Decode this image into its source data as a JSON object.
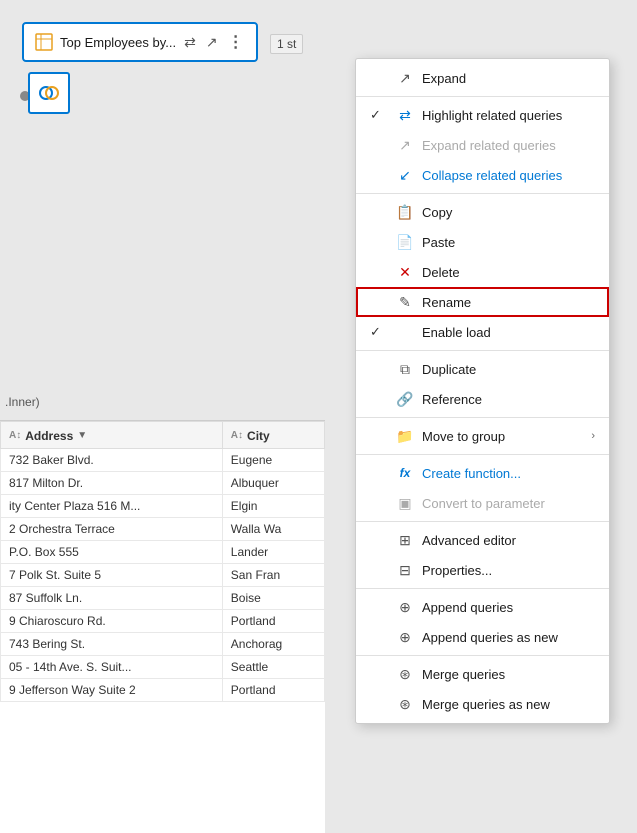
{
  "queryCard": {
    "title": "Top Employees by...",
    "stepBadge": "1 st",
    "actions": {
      "share": "⇄",
      "expand": "↗",
      "more": "⋮"
    }
  },
  "tableLabel": ".Inner)",
  "tableColumns": [
    {
      "id": "address",
      "label": "Address",
      "type": "abc"
    },
    {
      "id": "city",
      "label": "City",
      "type": "abc"
    }
  ],
  "tableRows": [
    {
      "address": "732 Baker Blvd.",
      "city": "Eugene"
    },
    {
      "address": "817 Milton Dr.",
      "city": "Albuquer"
    },
    {
      "address": "ity Center Plaza 516 M...",
      "city": "Elgin"
    },
    {
      "address": "2 Orchestra Terrace",
      "city": "Walla Wa"
    },
    {
      "address": "P.O. Box 555",
      "city": "Lander"
    },
    {
      "address": "7 Polk St. Suite 5",
      "city": "San Fran"
    },
    {
      "address": "87 Suffolk Ln.",
      "city": "Boise"
    },
    {
      "address": "9 Chiaroscuro Rd.",
      "city": "Portland"
    },
    {
      "address": "743 Bering St.",
      "city": "Anchorag"
    },
    {
      "address": "05 - 14th Ave. S. Suit...",
      "city": "Seattle"
    },
    {
      "address": "9 Jefferson Way Suite 2",
      "city": "Portland"
    }
  ],
  "contextMenu": {
    "items": [
      {
        "id": "expand",
        "label": "Expand",
        "icon": "expand-icon",
        "check": "",
        "disabled": false,
        "blue": false,
        "arrow": false
      },
      {
        "id": "separator1",
        "type": "separator"
      },
      {
        "id": "highlight",
        "label": "Highlight related queries",
        "icon": "highlight-icon",
        "check": "✓",
        "disabled": false,
        "blue": false,
        "arrow": false
      },
      {
        "id": "expand-related",
        "label": "Expand related queries",
        "icon": "expand-related-icon",
        "check": "",
        "disabled": true,
        "blue": false,
        "arrow": false
      },
      {
        "id": "collapse-related",
        "label": "Collapse related queries",
        "icon": "collapse-related-icon",
        "check": "",
        "disabled": false,
        "blue": true,
        "arrow": false
      },
      {
        "id": "separator2",
        "type": "separator"
      },
      {
        "id": "copy",
        "label": "Copy",
        "icon": "copy-icon",
        "check": "",
        "disabled": false,
        "blue": false,
        "arrow": false
      },
      {
        "id": "paste",
        "label": "Paste",
        "icon": "paste-icon",
        "check": "",
        "disabled": false,
        "blue": false,
        "arrow": false
      },
      {
        "id": "delete",
        "label": "Delete",
        "icon": "delete-icon",
        "check": "",
        "disabled": false,
        "blue": false,
        "arrow": false
      },
      {
        "id": "rename",
        "label": "Rename",
        "icon": "rename-icon",
        "check": "",
        "disabled": false,
        "blue": false,
        "arrow": false,
        "highlighted": true
      },
      {
        "id": "enable-load",
        "label": "Enable load",
        "icon": "enable-icon",
        "check": "✓",
        "disabled": false,
        "blue": false,
        "arrow": false
      },
      {
        "id": "separator3",
        "type": "separator"
      },
      {
        "id": "duplicate",
        "label": "Duplicate",
        "icon": "duplicate-icon",
        "check": "",
        "disabled": false,
        "blue": false,
        "arrow": false
      },
      {
        "id": "reference",
        "label": "Reference",
        "icon": "reference-icon",
        "check": "",
        "disabled": false,
        "blue": false,
        "arrow": false
      },
      {
        "id": "separator4",
        "type": "separator"
      },
      {
        "id": "move-group",
        "label": "Move to group",
        "icon": "move-group-icon",
        "check": "",
        "disabled": false,
        "blue": false,
        "arrow": true
      },
      {
        "id": "separator5",
        "type": "separator"
      },
      {
        "id": "create-function",
        "label": "Create function...",
        "icon": "fx-icon",
        "check": "",
        "disabled": false,
        "blue": true,
        "arrow": false
      },
      {
        "id": "convert-param",
        "label": "Convert to parameter",
        "icon": "convert-icon",
        "check": "",
        "disabled": true,
        "blue": false,
        "arrow": false
      },
      {
        "id": "separator6",
        "type": "separator"
      },
      {
        "id": "advanced-editor",
        "label": "Advanced editor",
        "icon": "editor-icon",
        "check": "",
        "disabled": false,
        "blue": false,
        "arrow": false
      },
      {
        "id": "properties",
        "label": "Properties...",
        "icon": "props-icon",
        "check": "",
        "disabled": false,
        "blue": false,
        "arrow": false
      },
      {
        "id": "separator7",
        "type": "separator"
      },
      {
        "id": "append-queries",
        "label": "Append queries",
        "icon": "append-icon",
        "check": "",
        "disabled": false,
        "blue": false,
        "arrow": false
      },
      {
        "id": "append-queries-new",
        "label": "Append queries as new",
        "icon": "append-new-icon",
        "check": "",
        "disabled": false,
        "blue": false,
        "arrow": false
      },
      {
        "id": "separator8",
        "type": "separator"
      },
      {
        "id": "merge-queries",
        "label": "Merge queries",
        "icon": "merge-icon",
        "check": "",
        "disabled": false,
        "blue": false,
        "arrow": false
      },
      {
        "id": "merge-queries-new",
        "label": "Merge queries as new",
        "icon": "merge-new-icon",
        "check": "",
        "disabled": false,
        "blue": false,
        "arrow": false
      }
    ]
  }
}
